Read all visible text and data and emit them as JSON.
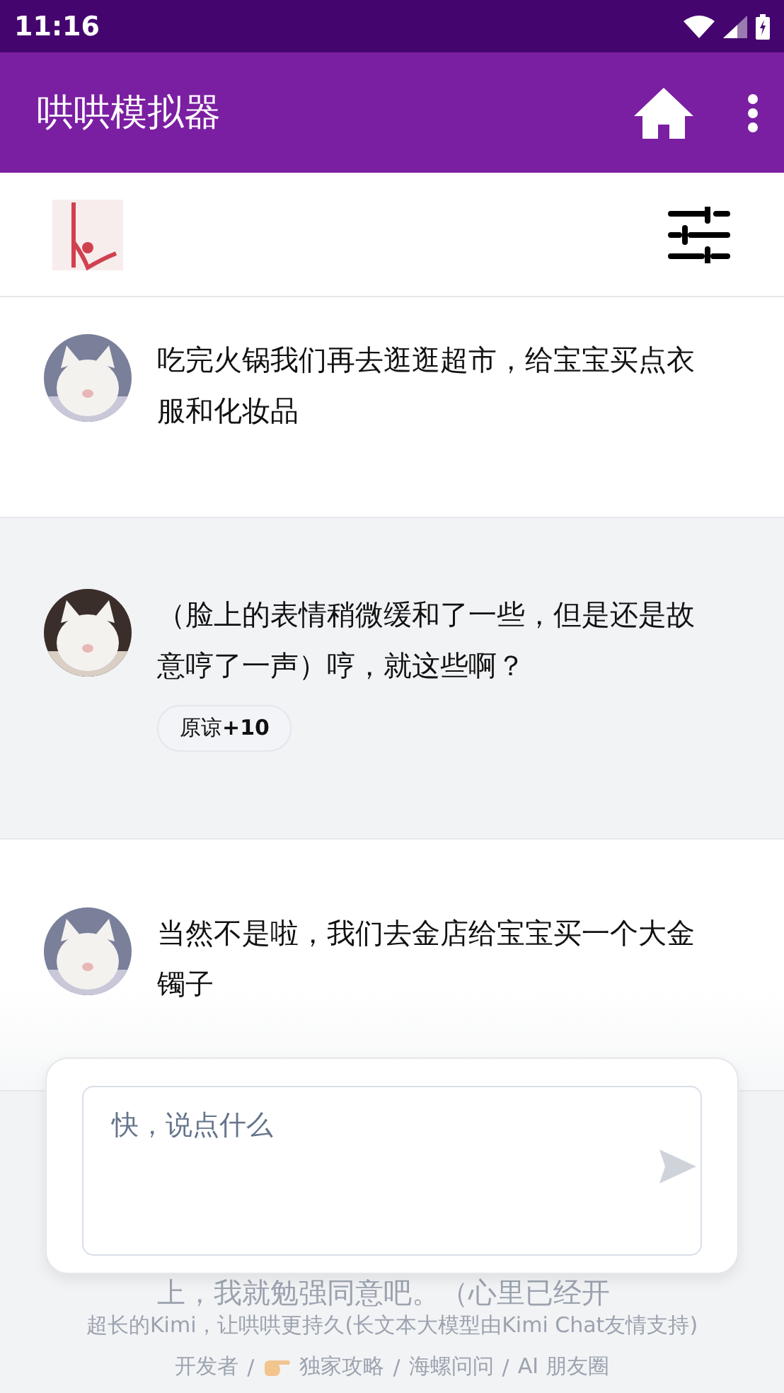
{
  "status_bar": {
    "time": "11:16"
  },
  "app_bar": {
    "title": "哄哄模拟器"
  },
  "messages": [
    {
      "kind": "user",
      "text": "吃完火锅我们再去逛逛超市，给宝宝买点衣服和化妆品"
    },
    {
      "kind": "ai",
      "text": "（脸上的表情稍微缓和了一些，但是还是故意哼了一声）哼，就这些啊？",
      "badge": "原谅**+10**"
    },
    {
      "kind": "user",
      "text": "当然不是啦，我们去金店给宝宝买一个大金镯子"
    },
    {
      "kind": "partial",
      "text": "上，我就勉强同意吧。（心里已经开"
    }
  ],
  "composer": {
    "placeholder": "快，说点什么"
  },
  "footer": {
    "credit": "超长的Kimi，让哄哄更持久(长文本大模型由Kimi Chat友情支持)",
    "links": [
      {
        "label": "开发者",
        "kind": "plain"
      },
      {
        "label": "独家攻略",
        "kind": "featured"
      },
      {
        "label": "海螺问问",
        "kind": "plain"
      },
      {
        "label": "AI 朋友圈",
        "kind": "plain"
      }
    ],
    "separators": [
      "/",
      "/",
      "/"
    ]
  }
}
